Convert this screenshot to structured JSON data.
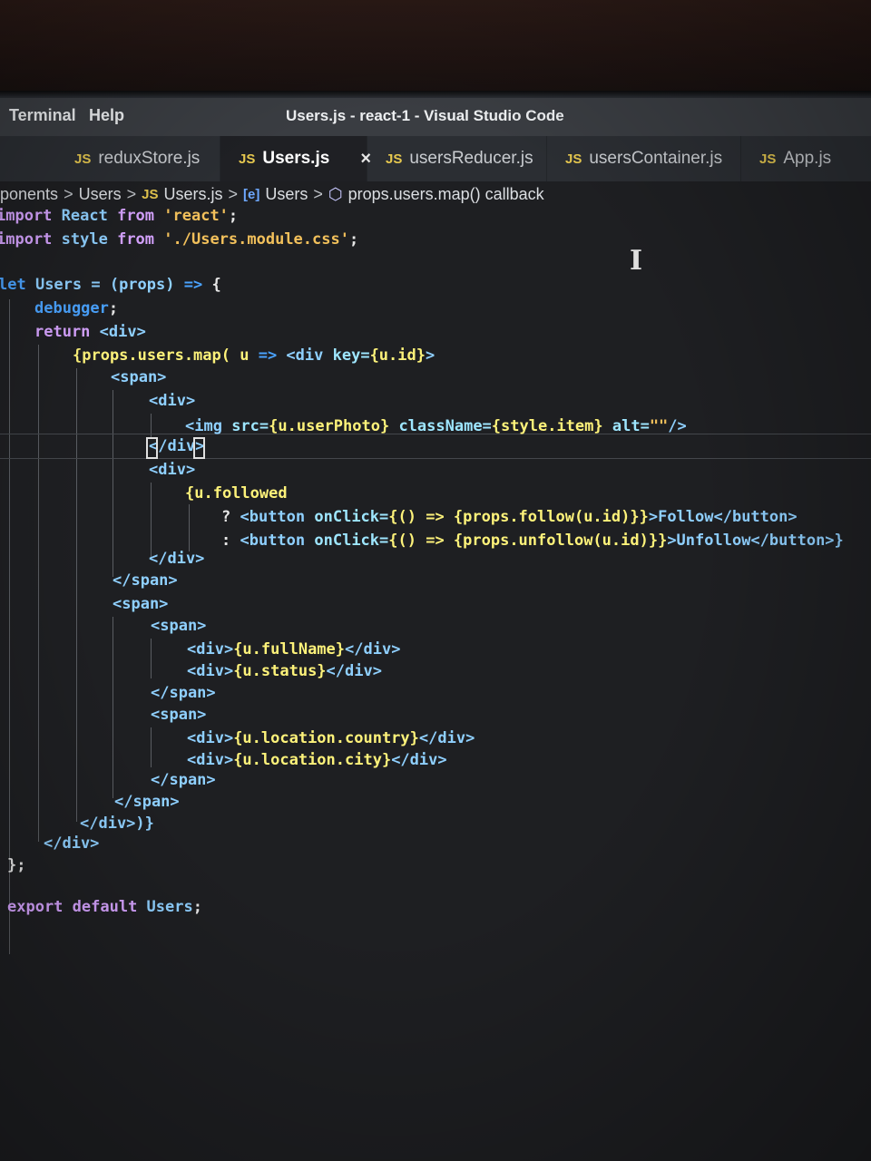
{
  "menu": {
    "terminal": "Terminal",
    "help": "Help"
  },
  "window_title": "Users.js - react-1 - Visual Studio Code",
  "tabs": [
    {
      "label": "reduxStore.js",
      "icon": "JS"
    },
    {
      "label": "Users.js",
      "icon": "JS",
      "active": true,
      "close": "×"
    },
    {
      "label": "usersReducer.js",
      "icon": "JS"
    },
    {
      "label": "usersContainer.js",
      "icon": "JS"
    },
    {
      "label": "App.js",
      "icon": "JS"
    }
  ],
  "breadcrumb": {
    "part1": "ponents",
    "part2": "Users",
    "js_icon": "JS",
    "part3": "Users.js",
    "symbol_icon": "[e]",
    "part4": "Users",
    "cube_icon": "⬡",
    "part5": "props.users.map() callback",
    "sep": ">"
  },
  "code": {
    "l1": {
      "kw": "import",
      "a": " React ",
      "kw2": "from",
      "str": " 'react'",
      "end": ";"
    },
    "l2": {
      "kw": "import",
      "a": " style ",
      "kw2": "from",
      "str": " './Users.module.css'",
      "end": ";"
    },
    "l3": {
      "kw": "let",
      "a": " Users = (props) ",
      "b": "=>",
      "c": " {"
    },
    "l4": {
      "a": "debugger",
      "b": ";"
    },
    "l5": {
      "kw": "return",
      "a": " <div>"
    },
    "l6": {
      "a": "{props.users.map( u ",
      "b": "=>",
      "c": " <div ",
      "d": "key=",
      "e": "{u.id}",
      "f": ">"
    },
    "l7": "<span>",
    "l8": "<div>",
    "l9": {
      "a": "<img ",
      "b": "src=",
      "c": "{u.userPhoto}",
      "d": " className=",
      "e": "{style.item}",
      "f": " alt=",
      "g": "\"\"",
      "h": "/>"
    },
    "l10": "</div>",
    "l11": "<div>",
    "l12": "{u.followed",
    "l13": {
      "a": "? ",
      "b": "<button ",
      "c": "onClick=",
      "d": "{() => {props.follow(u.id)}}",
      "e": ">Follow</button>"
    },
    "l14": {
      "a": ": ",
      "b": "<button ",
      "c": "onClick=",
      "d": "{() => {props.unfollow(u.id)}}",
      "e": ">Unfollow</button>}"
    },
    "l15": "</div>",
    "l16": "</span>",
    "l17": "<span>",
    "l18": "<span>",
    "l19": {
      "a": "<div>",
      "b": "{u.fullName}",
      "c": "</div>"
    },
    "l20": {
      "a": "<div>",
      "b": "{u.status}",
      "c": "</div>"
    },
    "l21": "</span>",
    "l22": "<span>",
    "l23": {
      "a": "<div>",
      "b": "{u.location.country}",
      "c": "</div>"
    },
    "l24": {
      "a": "<div>",
      "b": "{u.location.city}",
      "c": "</div>"
    },
    "l25": "</span>",
    "l26": "</span>",
    "l27": "</div>)}",
    "l28": "</div>",
    "l29": "};",
    "l30": {
      "kw": "export",
      "a": " default ",
      "b": "Users",
      "c": ";"
    }
  }
}
